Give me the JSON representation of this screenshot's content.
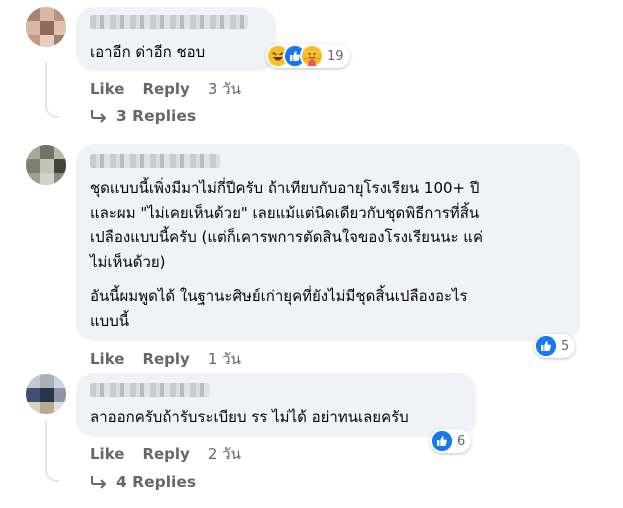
{
  "actions": {
    "like_label": "Like",
    "reply_label": "Reply"
  },
  "comments": [
    {
      "text_lines": [
        "เอาอีก ด่าอีก ชอบ"
      ],
      "time": "3 วัน",
      "reaction_count": "19",
      "reactions": [
        "haha-icon",
        "like-icon",
        "care-icon"
      ],
      "replies_label": "3 Replies"
    },
    {
      "paragraph1": [
        "ชุดแบบนี้เพิ่งมีมาไม่กี่ปีครับ ถ้าเทียบกับอายุโรงเรียน 100+ ปี",
        "และผม \"ไม่เคยเห็นด้วย\" เลยแม้แต่นิดเดียวกับชุดพิธีการที่สิ้น",
        "เปลืองแบบนี้ครับ (แต่ก็เคารพการตัดสินใจของโรงเรียนนะ แค่",
        "ไม่เห็นด้วย)"
      ],
      "paragraph2": [
        "อันนี้ผมพูดได้ ในฐานะศิษย์เก่ายุคที่ยังไม่มีชุดสิ้นเปลืองอะไร",
        "แบบนี้"
      ],
      "time": "1 วัน",
      "reaction_count": "5",
      "reactions": [
        "like-icon"
      ]
    },
    {
      "text_lines": [
        "ลาออกครับถ้ารับระเบียบ รร ไม่ได้ อย่าทนเลยครับ"
      ],
      "time": "2 วัน",
      "reaction_count": "6",
      "reactions": [
        "like-icon"
      ],
      "replies_label": "4 Replies"
    }
  ],
  "colors": {
    "bubble": "#f0f2f5",
    "secondary_text": "#65676b",
    "like_blue": "#1877f2"
  }
}
